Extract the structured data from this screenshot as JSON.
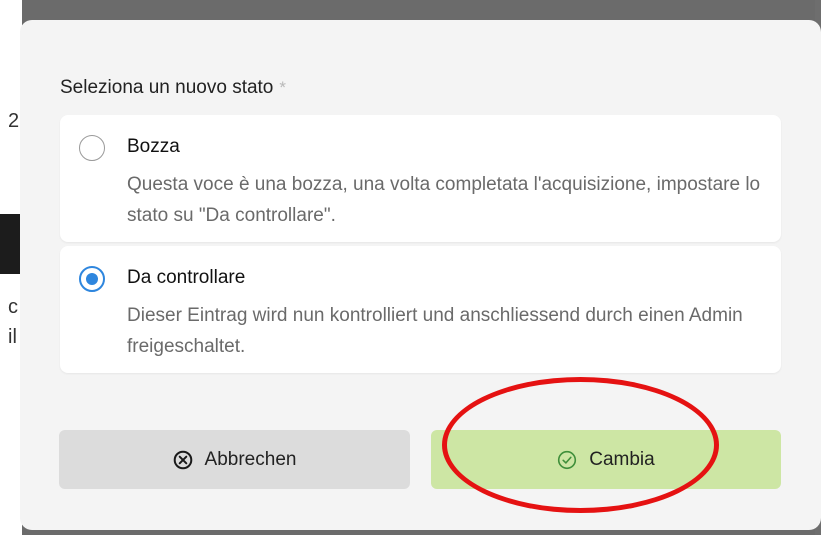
{
  "backdrop": {
    "fragment_1": "2",
    "fragment_2": "c",
    "fragment_3": "il"
  },
  "dialog": {
    "field_label": "Seleziona un nuovo stato",
    "required_marker": "*",
    "options": [
      {
        "title": "Bozza",
        "description": "Questa voce è una bozza, una volta completata l'acquisizione, impostare lo stato su \"Da controllare\".",
        "selected": false
      },
      {
        "title": "Da controllare",
        "description": "Dieser Eintrag wird nun kontrolliert und anschliessend durch einen Admin freigeschaltet.",
        "selected": true
      }
    ],
    "cancel_label": "Abbrechen",
    "cancel_icon": "circle-x-icon",
    "submit_label": "Cambia",
    "submit_icon": "circle-check-icon"
  },
  "colors": {
    "radio_selected": "#2e86de",
    "submit_button": "#cde6a4",
    "cancel_button": "#dcdcdc",
    "highlight_annotation": "#e51212"
  }
}
